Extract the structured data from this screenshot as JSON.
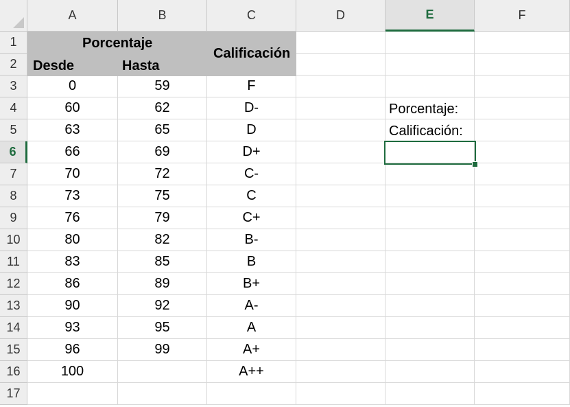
{
  "columns": [
    "A",
    "B",
    "C",
    "D",
    "E",
    "F"
  ],
  "rows": [
    "1",
    "2",
    "3",
    "4",
    "5",
    "6",
    "7",
    "8",
    "9",
    "10",
    "11",
    "12",
    "13",
    "14",
    "15",
    "16",
    "17"
  ],
  "header": {
    "porcentaje": "Porcentaje",
    "desde": "Desde",
    "hasta": "Hasta",
    "calificacion": "Calificación"
  },
  "grades": [
    {
      "desde": "0",
      "hasta": "59",
      "calificacion": "F"
    },
    {
      "desde": "60",
      "hasta": "62",
      "calificacion": "D-"
    },
    {
      "desde": "63",
      "hasta": "65",
      "calificacion": "D"
    },
    {
      "desde": "66",
      "hasta": "69",
      "calificacion": "D+"
    },
    {
      "desde": "70",
      "hasta": "72",
      "calificacion": "C-"
    },
    {
      "desde": "73",
      "hasta": "75",
      "calificacion": "C"
    },
    {
      "desde": "76",
      "hasta": "79",
      "calificacion": "C+"
    },
    {
      "desde": "80",
      "hasta": "82",
      "calificacion": "B-"
    },
    {
      "desde": "83",
      "hasta": "85",
      "calificacion": "B"
    },
    {
      "desde": "86",
      "hasta": "89",
      "calificacion": "B+"
    },
    {
      "desde": "90",
      "hasta": "92",
      "calificacion": "A-"
    },
    {
      "desde": "93",
      "hasta": "95",
      "calificacion": "A"
    },
    {
      "desde": "96",
      "hasta": "99",
      "calificacion": "A+"
    },
    {
      "desde": "100",
      "hasta": "",
      "calificacion": "A++"
    }
  ],
  "lookup": {
    "porcentaje_label": "Porcentaje:",
    "calificacion_label": "Calificación:"
  },
  "selection": {
    "column": "E",
    "row": "6"
  },
  "colors": {
    "accent": "#1e6b3e",
    "header_fill": "#bfbfbf"
  }
}
